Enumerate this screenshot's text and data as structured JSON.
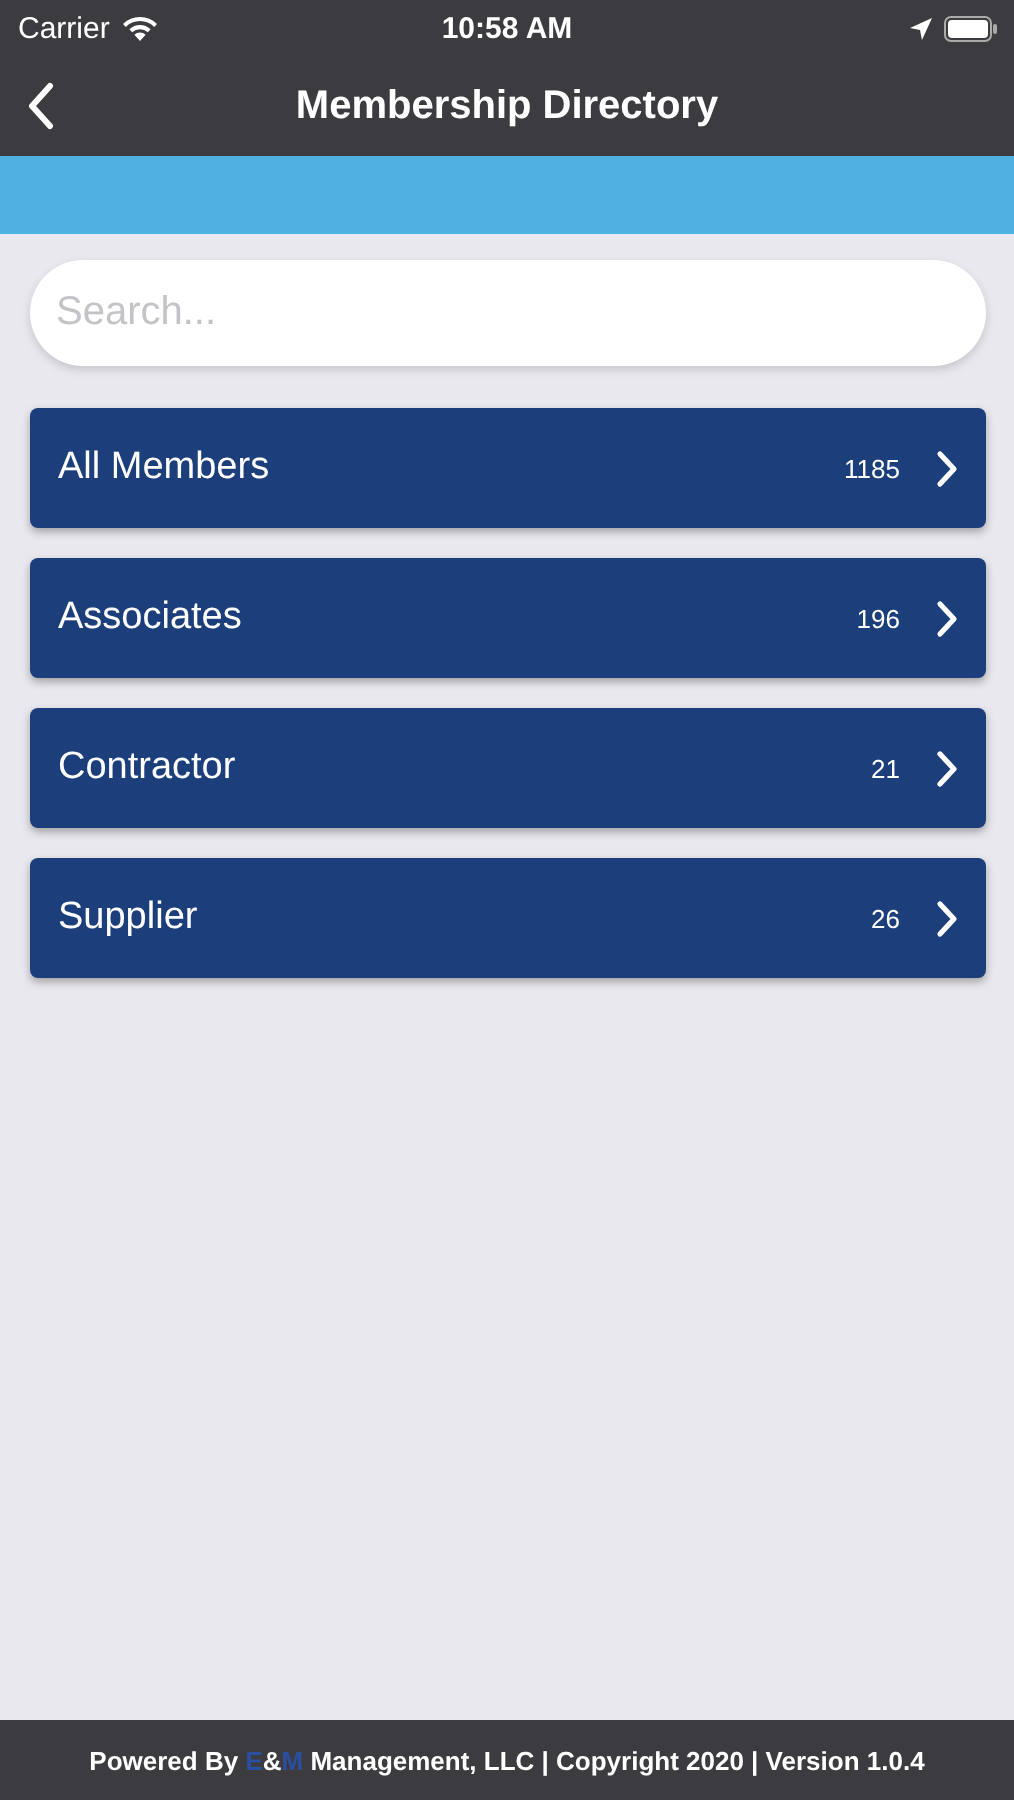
{
  "status_bar": {
    "carrier": "Carrier",
    "time": "10:58 AM"
  },
  "nav_bar": {
    "title": "Membership Directory"
  },
  "search": {
    "placeholder": "Search..."
  },
  "categories": [
    {
      "label": "All Members",
      "count": "1185"
    },
    {
      "label": "Associates",
      "count": "196"
    },
    {
      "label": "Contractor",
      "count": "21"
    },
    {
      "label": "Supplier",
      "count": "26"
    }
  ],
  "footer": [
    {
      "kind": "plain",
      "text": "Powered By "
    },
    {
      "kind": "accent",
      "text": "E"
    },
    {
      "kind": "plain",
      "text": "&"
    },
    {
      "kind": "accent",
      "text": "M"
    },
    {
      "kind": "plain",
      "text": " Management, LLC | Copyright 2020 | Version 1.0.4"
    }
  ]
}
